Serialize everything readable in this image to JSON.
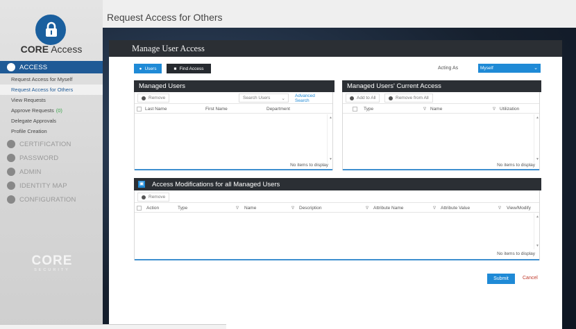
{
  "brand": {
    "bold": "CORE",
    "rest": " Access"
  },
  "sidebar": {
    "access_label": "ACCESS",
    "sub_items": [
      {
        "label": "Request Access for Myself"
      },
      {
        "label": "Request Access for Others"
      },
      {
        "label": "View Requests"
      },
      {
        "label": "Approve Requests",
        "count": "(0)"
      },
      {
        "label": "Delegate Approvals"
      },
      {
        "label": "Profile Creation"
      }
    ],
    "sections": [
      {
        "label": "CERTIFICATION",
        "icon": "check-circle-icon"
      },
      {
        "label": "PASSWORD",
        "icon": "lock-icon"
      },
      {
        "label": "ADMIN",
        "icon": "gear-icon"
      },
      {
        "label": "IDENTITY MAP",
        "icon": "network-icon"
      },
      {
        "label": "CONFIGURATION",
        "icon": "wrench-icon"
      }
    ],
    "footer_logo": "CORE",
    "footer_sub": "SECURITY"
  },
  "page_title": "Request Access for Others",
  "panel": {
    "title": "Manage User Access",
    "tabs": {
      "users": "Users",
      "find_access": "Find Access"
    },
    "acting_as_label": "Acting As",
    "acting_as_value": "Myself"
  },
  "managed_users": {
    "title": "Managed Users",
    "remove_label": "Remove",
    "search_placeholder": "Search Users",
    "advanced_search": "Advanced Search",
    "columns": [
      "Last Name",
      "First Name",
      "Department"
    ],
    "empty_text": "No items to display"
  },
  "current_access": {
    "title": "Managed Users' Current Access",
    "add_to_all": "Add to All",
    "remove_from_all": "Remove from All",
    "columns": [
      "Type",
      "Name",
      "Utilization"
    ],
    "empty_text": "No items to display"
  },
  "modifications": {
    "title": "Access Modifications for all Managed Users",
    "remove_label": "Remove",
    "columns": [
      "Action",
      "Type",
      "Name",
      "Description",
      "Attribute Name",
      "Attribute Value",
      "View/Modify"
    ],
    "empty_text": "No items to display"
  },
  "actions": {
    "submit": "Submit",
    "cancel": "Cancel"
  },
  "colors": {
    "accent": "#1f8ad6",
    "sidebar_active": "#1f5a96",
    "header_dark": "#2b2f34",
    "cancel": "#c0392b",
    "count": "#3aa64a"
  }
}
